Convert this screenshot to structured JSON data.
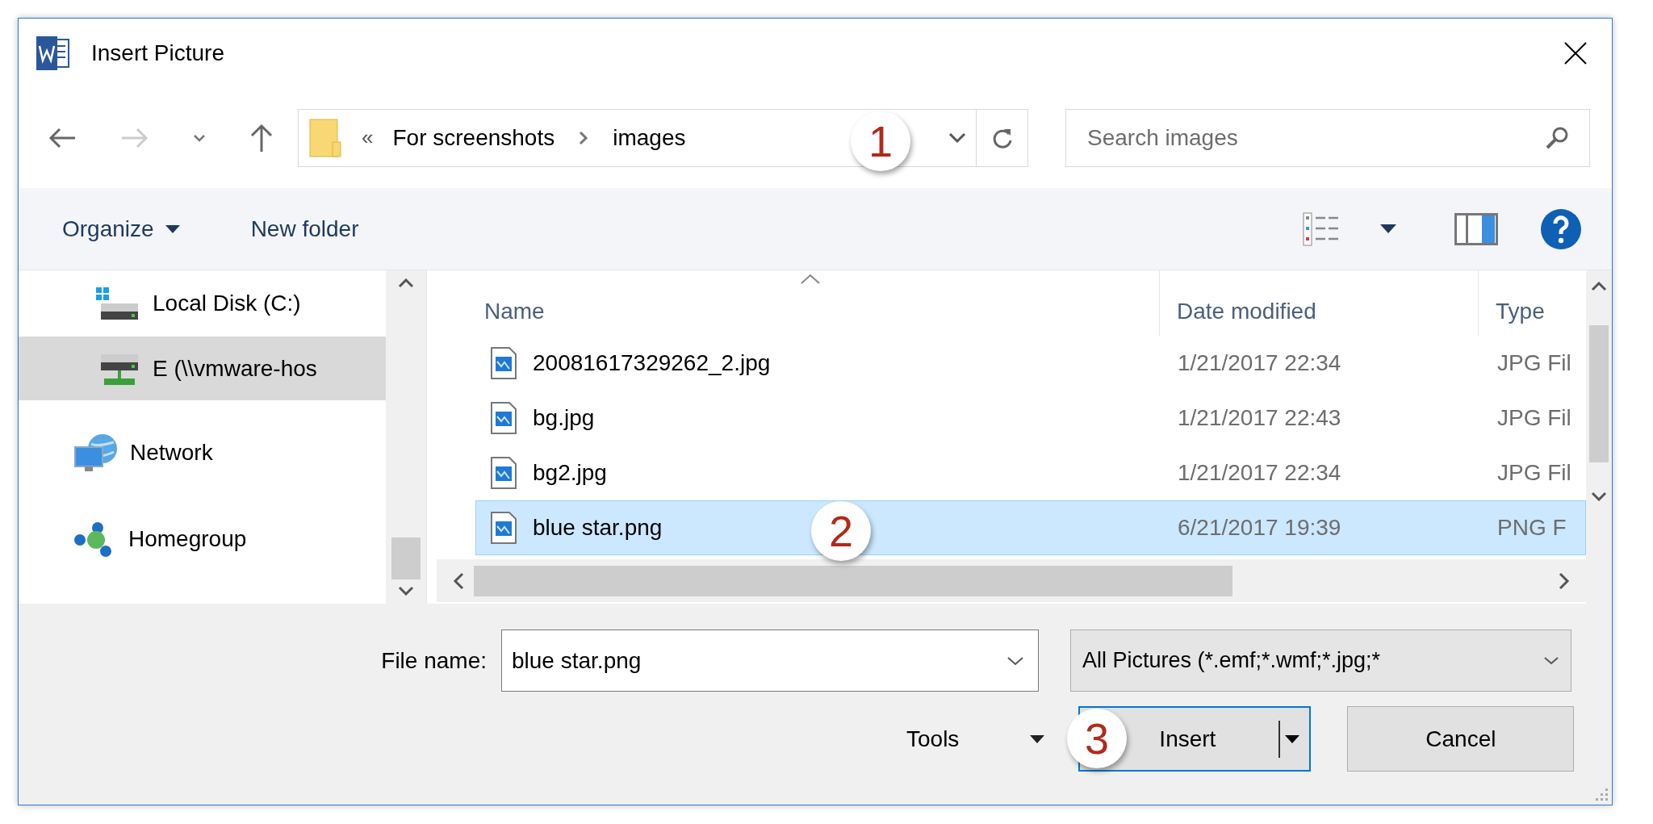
{
  "window": {
    "title": "Insert Picture"
  },
  "address": {
    "overflow": "«",
    "crumbs": [
      "For screenshots",
      "images"
    ]
  },
  "search": {
    "placeholder": "Search images"
  },
  "toolbar": {
    "organize": "Organize",
    "new_folder": "New folder"
  },
  "nav_pane": [
    {
      "label": "Local Disk (C:)",
      "kind": "drive",
      "selected": false
    },
    {
      "label": "E (\\\\vmware-hos",
      "kind": "network-drive",
      "selected": true
    },
    {
      "label": "Network",
      "kind": "network",
      "selected": false
    },
    {
      "label": "Homegroup",
      "kind": "homegroup",
      "selected": false
    }
  ],
  "file_list": {
    "columns": [
      "Name",
      "Date modified",
      "Type"
    ],
    "rows": [
      {
        "name": "20081617329262_2.jpg",
        "date": "1/21/2017 22:34",
        "type": "JPG Fil",
        "selected": false
      },
      {
        "name": "bg.jpg",
        "date": "1/21/2017 22:43",
        "type": "JPG Fil",
        "selected": false
      },
      {
        "name": "bg2.jpg",
        "date": "1/21/2017 22:34",
        "type": "JPG Fil",
        "selected": false
      },
      {
        "name": "blue star.png",
        "date": "6/21/2017 19:39",
        "type": "PNG F",
        "selected": true
      }
    ]
  },
  "file_name": {
    "label": "File name:",
    "value": "blue star.png"
  },
  "file_type": {
    "value": "All Pictures (*.emf;*.wmf;*.jpg;*"
  },
  "tools": "Tools",
  "buttons": [
    {
      "label": "Insert",
      "kind": "split"
    },
    {
      "label": "Cancel",
      "kind": "plain"
    }
  ],
  "callouts": [
    "1",
    "2",
    "3"
  ]
}
